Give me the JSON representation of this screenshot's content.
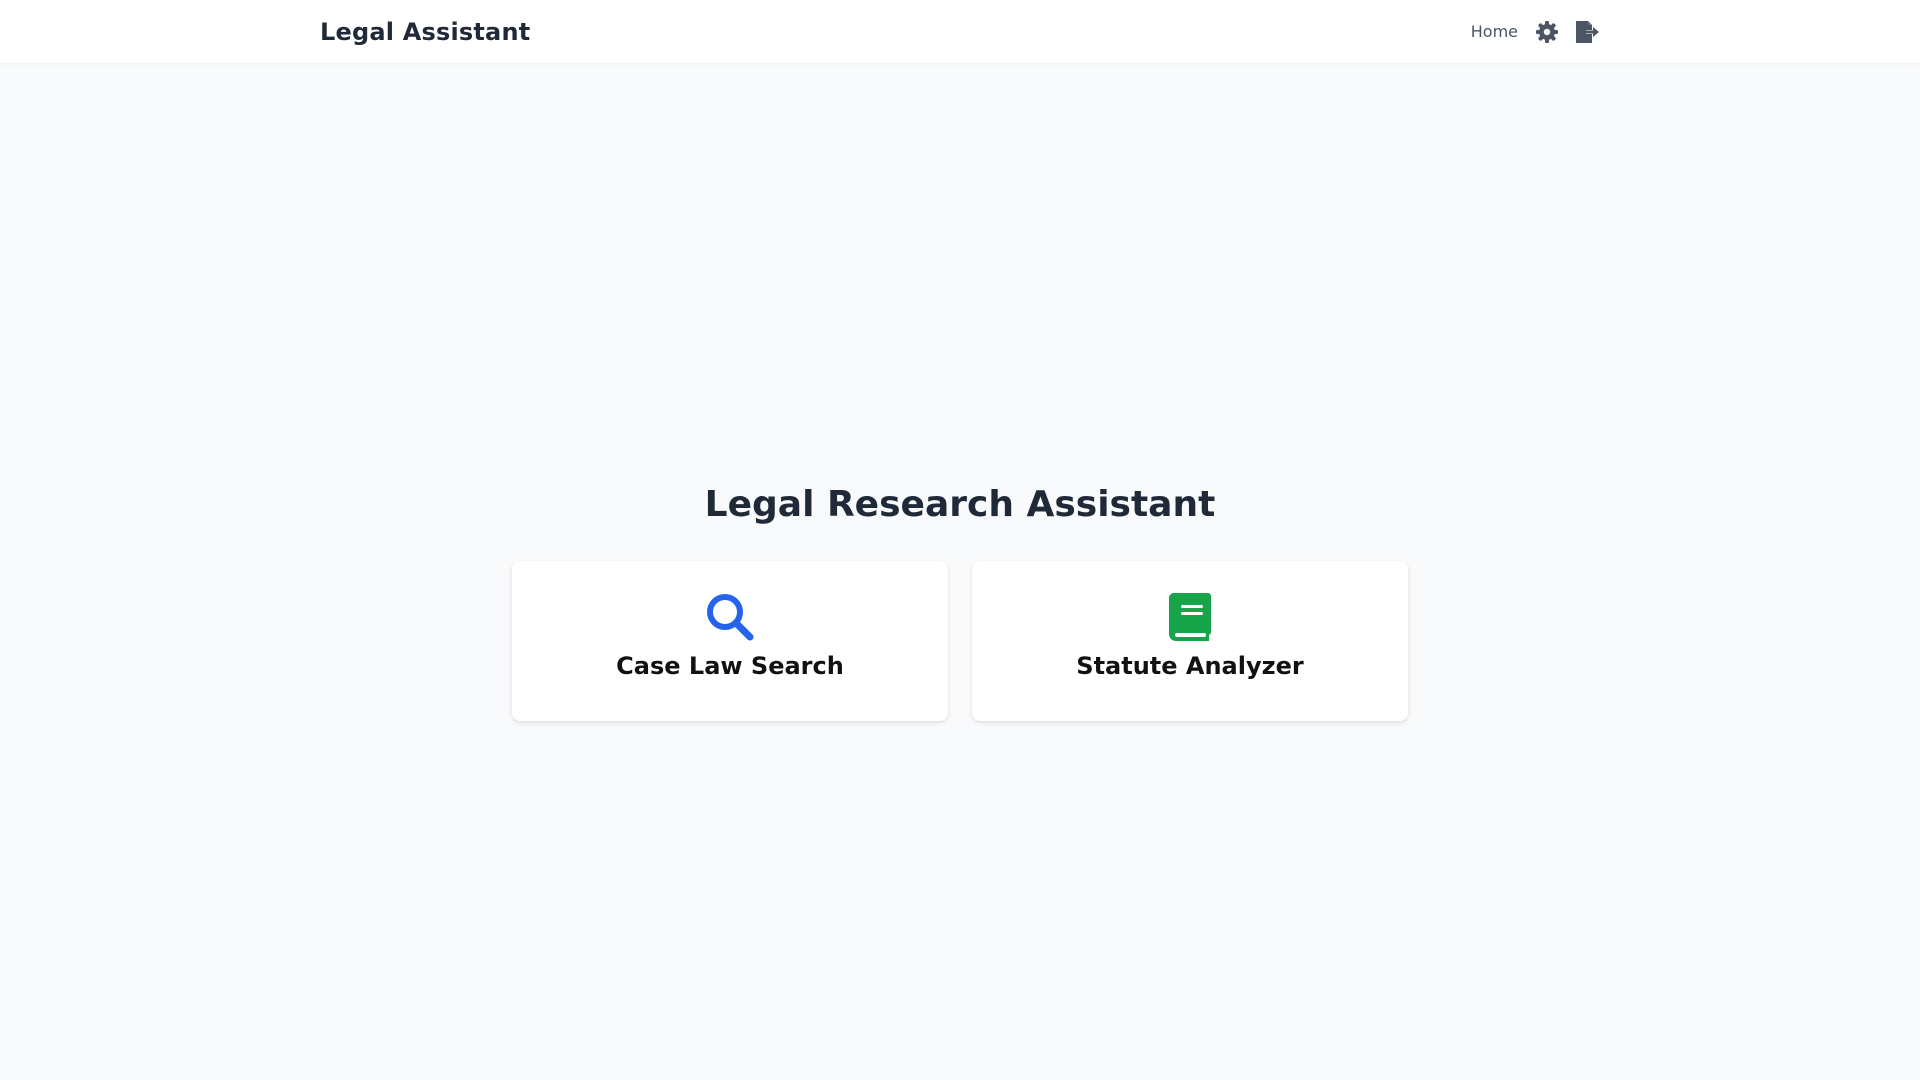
{
  "navbar": {
    "brand": "Legal Assistant",
    "home_label": "Home",
    "icons": [
      "gear-icon",
      "sign-out-icon"
    ],
    "icon_color": "#4b5563"
  },
  "main": {
    "title": "Legal Research Assistant",
    "cards": [
      {
        "label": "Case Law Search",
        "icon": "search-icon",
        "icon_color": "#2563eb"
      },
      {
        "label": "Statute Analyzer",
        "icon": "book-icon",
        "icon_color": "#16a34a"
      }
    ]
  }
}
